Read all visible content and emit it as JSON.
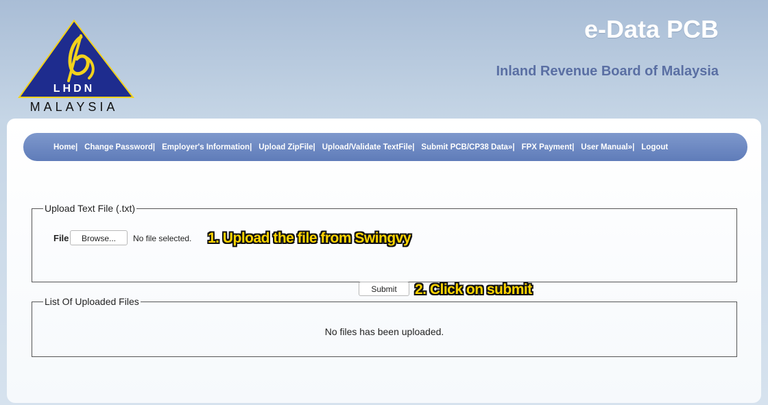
{
  "header": {
    "app_title": "e-Data PCB",
    "org_title": "Inland Revenue Board of Malaysia",
    "logo": {
      "line1": "LHDN",
      "line2": "MALAYSIA"
    }
  },
  "nav": {
    "items": [
      {
        "label": "Home",
        "sep": "|"
      },
      {
        "label": "Change Password",
        "sep": "|"
      },
      {
        "label": "Employer's Information",
        "sep": "|"
      },
      {
        "label": "Upload ZipFile",
        "sep": "|"
      },
      {
        "label": "Upload/Validate TextFile",
        "sep": "|"
      },
      {
        "label": "Submit PCB/CP38 Data»",
        "sep": "|"
      },
      {
        "label": "FPX Payment",
        "sep": "|"
      },
      {
        "label": "User Manual»",
        "sep": "|"
      },
      {
        "label": "Logout",
        "sep": ""
      }
    ]
  },
  "upload": {
    "legend": "Upload Text File (.txt)",
    "file_label": "File :",
    "browse_label": "Browse...",
    "no_file_text": "No file selected.",
    "submit_label": "Submit"
  },
  "annotations": {
    "step1": "1. Upload the file from Swingvy",
    "step2": "2. Click on submit"
  },
  "uploaded_list": {
    "legend": "List Of Uploaded Files",
    "empty_message": "No files has been uploaded."
  },
  "colors": {
    "logo_triangle": "#1e2c8e",
    "logo_accent": "#f2d21c",
    "nav_bar": "#6b86c0",
    "org_title": "#5a6fa3",
    "annotation": "#ffd400"
  }
}
